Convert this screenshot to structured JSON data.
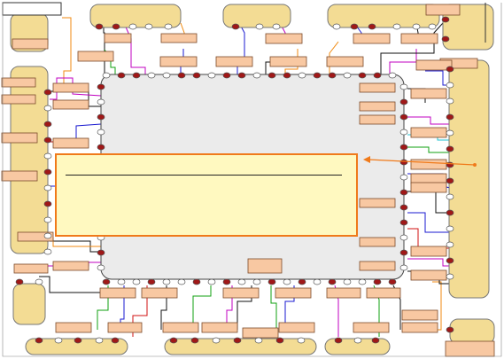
{
  "diagram": {
    "note_text": "",
    "colors": {
      "pad_fill": "#f3dc94",
      "pad_stroke": "#777777",
      "core_fill": "#ebebeb",
      "core_stroke": "#444444",
      "label_fill": "#f8c8a2",
      "label_stroke": "#7a4a2a",
      "pin_red": "#a01818",
      "pin_open": "#ffffff",
      "note_fill": "#fff9c0",
      "note_stroke": "#f07a1a",
      "arrow": "#f07a1a",
      "wire_palette": [
        "#1a1ad0",
        "#c000c0",
        "#10a010",
        "#d01010",
        "#f08a10",
        "#20c0d0",
        "#101010",
        "#a0a000"
      ]
    }
  }
}
